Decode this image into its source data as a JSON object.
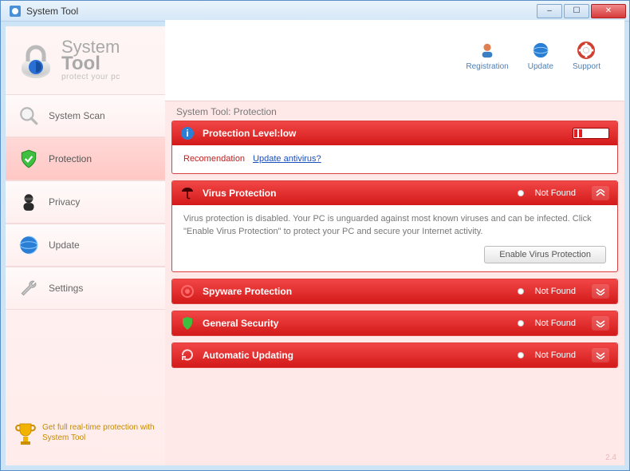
{
  "window": {
    "title": "System Tool"
  },
  "brand": {
    "line1": "System",
    "line2": "Tool",
    "tagline": "protect your pc"
  },
  "topbar": {
    "registration": "Registration",
    "update": "Update",
    "support": "Support"
  },
  "sidebar": {
    "items": [
      {
        "label": "System Scan"
      },
      {
        "label": "Protection"
      },
      {
        "label": "Privacy"
      },
      {
        "label": "Update"
      },
      {
        "label": "Settings"
      }
    ],
    "promo": "Get full real-time protection with System Tool"
  },
  "page": {
    "title": "System Tool: Protection"
  },
  "protection_level": {
    "label": "Protection Level:low",
    "reco_label": "Recomendation",
    "reco_link": "Update antivirus?"
  },
  "panels": {
    "virus": {
      "title": "Virus Protection",
      "status": "Not Found",
      "body": "Virus protection is disabled. Your PC is unguarded against most known viruses and can be infected. Click \"Enable Virus Protection\" to protect your PC and secure your Internet activity.",
      "button": "Enable Virus Protection"
    },
    "spyware": {
      "title": "Spyware Protection",
      "status": "Not Found"
    },
    "general": {
      "title": "General Security",
      "status": "Not Found"
    },
    "auto": {
      "title": "Automatic Updating",
      "status": "Not Found"
    }
  },
  "version": "2.4"
}
